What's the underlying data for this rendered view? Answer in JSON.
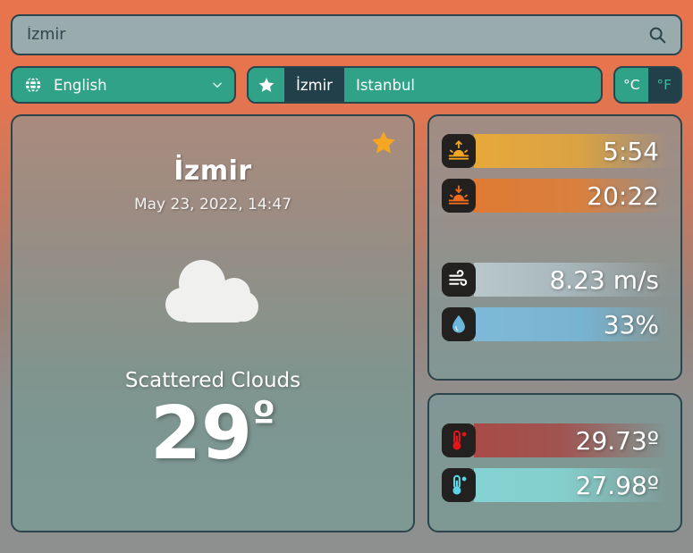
{
  "search": {
    "value": "İzmir",
    "placeholder": "İzmir",
    "icon": "search-icon"
  },
  "toolbar": {
    "language": {
      "selected": "English",
      "globe_icon": "globe-icon",
      "chevron_icon": "chevron-down-icon"
    },
    "favorites": {
      "star_icon": "star-icon",
      "items": [
        {
          "label": "İzmir",
          "active": true
        },
        {
          "label": "Istanbul",
          "active": false
        }
      ]
    },
    "units": [
      {
        "label": "°C",
        "active": true
      },
      {
        "label": "°F",
        "active": false
      }
    ]
  },
  "main_card": {
    "favorite_star_icon": "star-icon",
    "city": "İzmir",
    "datetime": "May 23, 2022, 14:47",
    "weather_icon": "cloud-icon",
    "condition": "Scattered Clouds",
    "temperature": "29",
    "degree_symbol": "º"
  },
  "sun_panel": {
    "rows": [
      {
        "icon": "sunrise-icon",
        "value": "5:54"
      },
      {
        "icon": "sunset-icon",
        "value": "20:22"
      },
      {
        "icon": "wind-icon",
        "value": "8.23 m/s"
      },
      {
        "icon": "humidity-icon",
        "value": "33%"
      }
    ]
  },
  "temp_panel": {
    "rows": [
      {
        "icon": "thermometer-hot-icon",
        "value": "29.73º"
      },
      {
        "icon": "thermometer-cold-icon",
        "value": "27.98º"
      }
    ]
  },
  "colors": {
    "background_top": "#e8744e",
    "background_bottom": "#8e9090",
    "accent_teal": "#2fa287",
    "dark_slate": "#22404a",
    "border": "#2c444c",
    "search_field": "#9aabad",
    "star_gold": "#f5a623"
  }
}
